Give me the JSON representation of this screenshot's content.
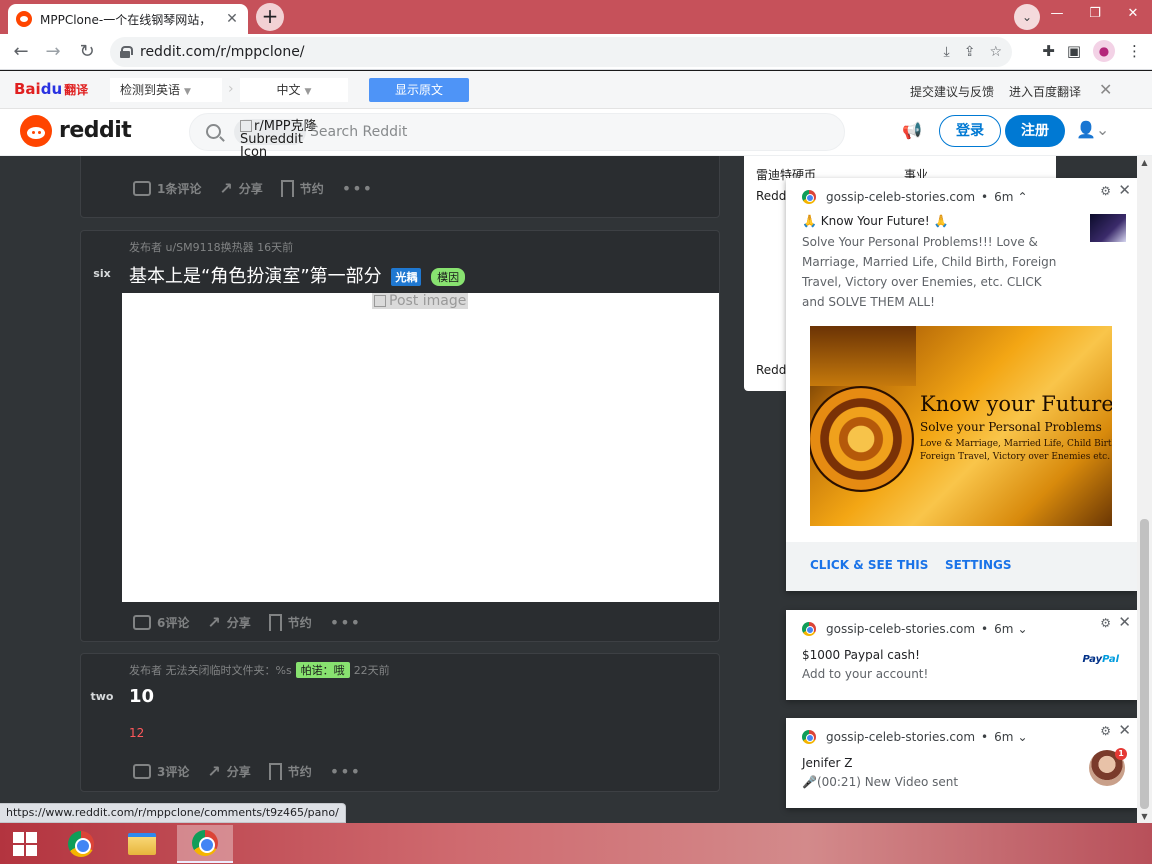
{
  "browser": {
    "tab_title": "MPPClone-一个在线钢琴网站，",
    "new_tab": "+",
    "url": "reddit.com/r/mppclone/",
    "status_url": "https://www.reddit.com/r/mppclone/comments/t9z465/pano/"
  },
  "baidu_bar": {
    "logo_bai": "Bai",
    "logo_du": "du",
    "logo_fy": "翻译",
    "source_lang": "检测到英语",
    "target_lang": "中文",
    "show_original": "显示原文",
    "feedback": "提交建议与反馈",
    "enter_baidu": "进入百度翻译"
  },
  "reddit_header": {
    "wordmark": "reddit",
    "subreddit_chip": "r/MPP克隆 Subreddit Icon",
    "search_placeholder": "Search Reddit",
    "login": "登录",
    "signup": "注册"
  },
  "posts": [
    {
      "comments": "1条评论",
      "share": "分享",
      "save": "节约"
    },
    {
      "votes": "six",
      "meta": "发布者 u/SM9118换热器 16天前",
      "title": "基本上是“角色扮演室”第一部分",
      "flair1": "光耦",
      "flair2": "模因",
      "image_alt": "Post image",
      "comments": "6评论",
      "share": "分享",
      "save": "节约"
    },
    {
      "votes": "two",
      "meta_prefix": "发布者 无法关闭临时文件夹：%s",
      "meta_flair": "帕诺：哦",
      "meta_time": "22天前",
      "title": "10",
      "body": "12",
      "comments": "3评论",
      "share": "分享",
      "save": "节约"
    }
  ],
  "sidebar": {
    "row_label": "雷迪特硬币",
    "row_value": "事业",
    "reddit_label_1": "Redd",
    "reddit_label_2": "Redd"
  },
  "notifications": [
    {
      "source": "gossip-celeb-stories.com",
      "time": "6m",
      "title": "🙏 Know Your Future! 🙏",
      "body": "Solve Your Personal Problems!!! Love & Marriage, Married Life, Child Birth, Foreign Travel, Victory over Enemies, etc. CLICK and SOLVE THEM ALL!",
      "image_heading": "Know your Future!",
      "image_sub": "Solve your Personal Problems",
      "image_line1": "Love & Marriage, Married Life, Child Birth",
      "image_line2": "Foreign Travel, Victory over Enemies etc.",
      "action1": "CLICK & SEE THIS",
      "action2": "SETTINGS"
    },
    {
      "source": "gossip-celeb-stories.com",
      "time": "6m",
      "title": "$1000 Paypal cash!",
      "body": "Add to your account!",
      "logo_pay": "Pay",
      "logo_pal": "Pal"
    },
    {
      "source": "gossip-celeb-stories.com",
      "time": "6m",
      "title": "Jenifer Z",
      "body": "🎤(00:21) New Video sent",
      "badge": "1"
    }
  ]
}
